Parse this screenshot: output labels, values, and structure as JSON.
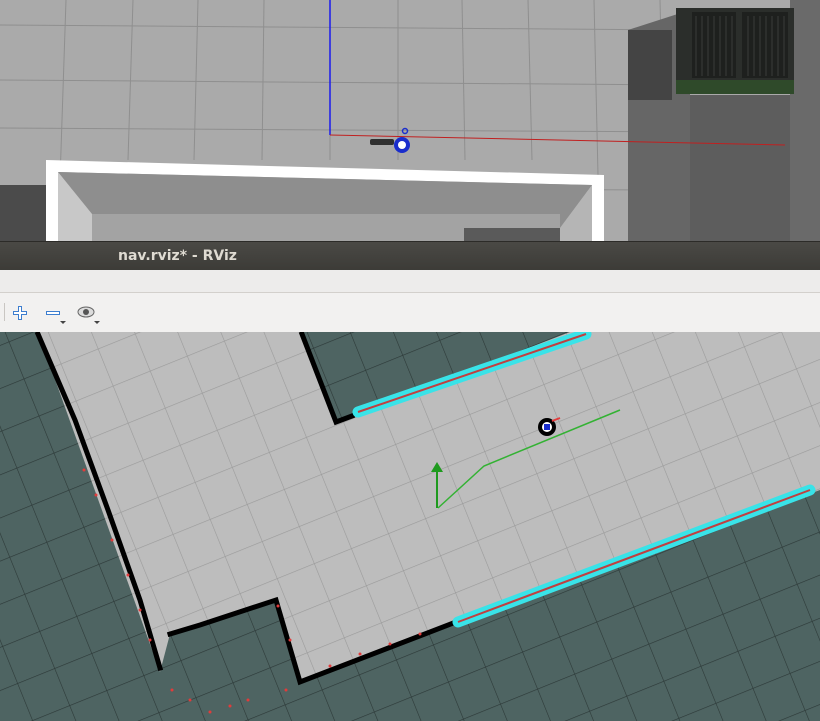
{
  "window": {
    "title": "nav.rviz* - RViz"
  },
  "toolbar": {
    "buttons": [
      {
        "name": "add-button",
        "icon": "plus-icon"
      },
      {
        "name": "remove-button",
        "icon": "minus-icon"
      },
      {
        "name": "view-button",
        "icon": "eye-icon"
      }
    ]
  },
  "colors": {
    "grid_floor": "#a9a9a9",
    "wall_white": "#ffffff",
    "map_free": "#bdbdbd",
    "map_unknown": "#4e6462",
    "obstacle": "#000000",
    "laser_scan": "#e23b3b",
    "inflation": "#39e3e8",
    "global_plan": "#33b233",
    "goal_arrow": "#1e9a1e",
    "robot_marker": "#1a2dcc"
  }
}
